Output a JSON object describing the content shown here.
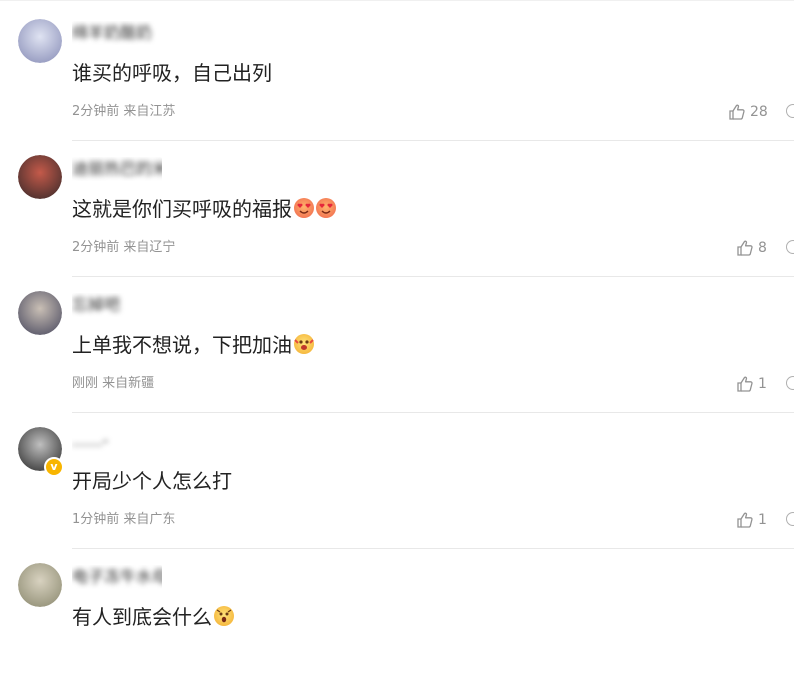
{
  "comments": [
    {
      "username": "绵羊奶酪奶",
      "text": "谁买的呼吸，自己出列",
      "emojis": [],
      "time": "2分钟前",
      "location": "来自江苏",
      "likes": "28",
      "verified": false,
      "avatar_colors": [
        "#dfe3f2",
        "#8a8fb8"
      ]
    },
    {
      "username": "迪丽热巴的米粉宝宝的妃妃",
      "text": "这就是你们买呼吸的福报",
      "emojis": [
        "heart-eyes-emoji",
        "heart-eyes-emoji"
      ],
      "time": "2分钟前",
      "location": "来自辽宁",
      "likes": "8",
      "verified": false,
      "avatar_colors": [
        "#c45a4a",
        "#3b2a2a"
      ]
    },
    {
      "username": "忘掉吧",
      "text": "上单我不想说，下把加油",
      "emojis": [
        "cheering-emoji"
      ],
      "time": "刚刚",
      "location": "来自新疆",
      "likes": "1",
      "verified": false,
      "avatar_colors": [
        "#c9bfb5",
        "#4b4b60"
      ]
    },
    {
      "username": "......-",
      "text": "开局少个人怎么打",
      "emojis": [],
      "time": "1分钟前",
      "location": "来自广东",
      "likes": "1",
      "verified": true,
      "avatar_colors": [
        "#bfbfbf",
        "#2e2e2e"
      ]
    },
    {
      "username": "电子冻牛水母",
      "text": "有人到底会什么",
      "emojis": [
        "shocked-emoji"
      ],
      "time": "",
      "location": "",
      "likes": "",
      "verified": false,
      "avatar_colors": [
        "#d8d2c0",
        "#8c8a70"
      ]
    }
  ],
  "colors": {
    "meta": "#939393",
    "text": "#222222",
    "divider": "#e8e8e8"
  }
}
